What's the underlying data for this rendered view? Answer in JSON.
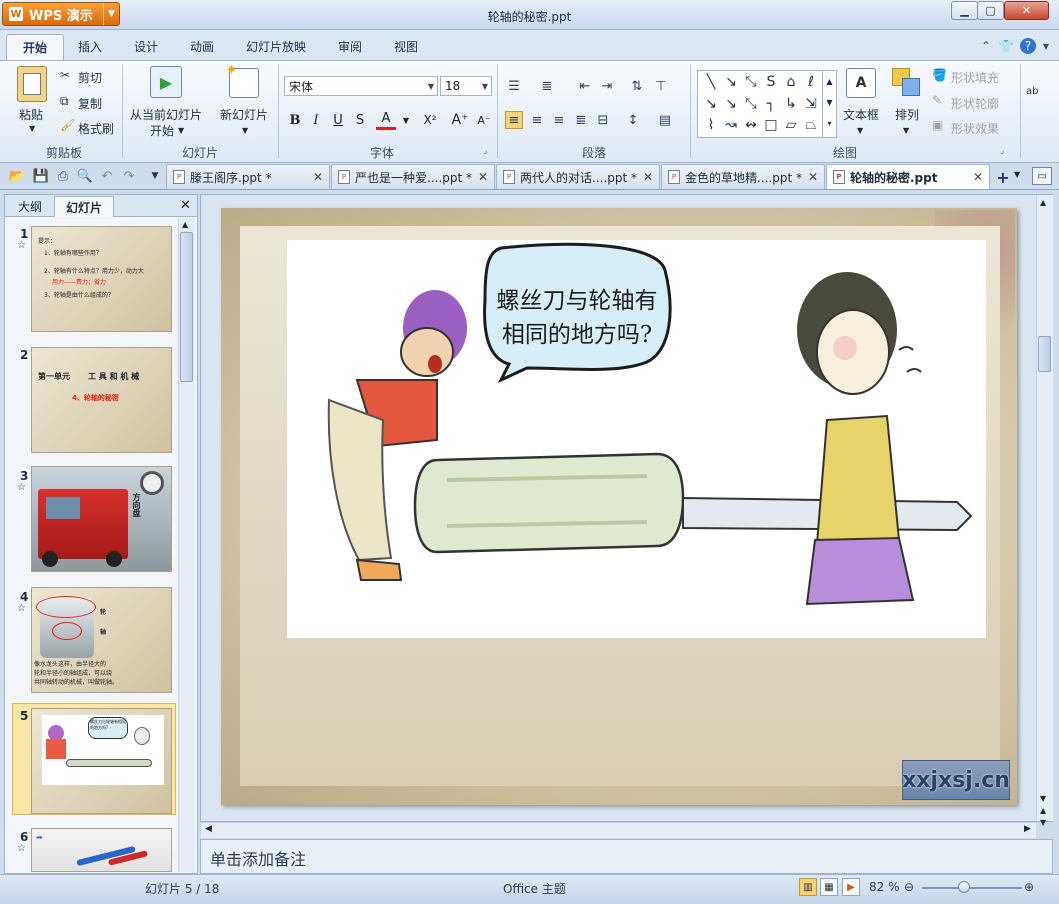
{
  "app": {
    "name": "WPS 演示",
    "window_title": "轮轴的秘密.ppt"
  },
  "ribbon_tabs": [
    "开始",
    "插入",
    "设计",
    "动画",
    "幻灯片放映",
    "审阅",
    "视图"
  ],
  "ribbon": {
    "clipboard": {
      "group": "剪贴板",
      "paste": "粘贴",
      "cut": "剪切",
      "copy": "复制",
      "format_painter": "格式刷"
    },
    "slides": {
      "group": "幻灯片",
      "from_current_line1": "从当前幻灯片",
      "from_current_line2": "开始",
      "new_slide": "新幻灯片"
    },
    "font": {
      "group": "字体",
      "font_name": "宋体",
      "font_size": "18"
    },
    "paragraph": {
      "group": "段落"
    },
    "drawing": {
      "group": "绘图",
      "textbox": "文本框",
      "arrange": "排列",
      "shape_fill": "形状填充",
      "shape_outline": "形状轮廓",
      "shape_effect": "形状效果"
    }
  },
  "doc_tabs": [
    {
      "name": "滕王阁序.ppt *"
    },
    {
      "name": "严也是一种爱....ppt *"
    },
    {
      "name": "两代人的对话....ppt *"
    },
    {
      "name": "金色的草地精....ppt *"
    },
    {
      "name": "轮轴的秘密.ppt"
    }
  ],
  "left_pane": {
    "tab_outline": "大纲",
    "tab_slides": "幻灯片",
    "slides": [
      {
        "num": "1",
        "lines": [
          "提示：",
          "1、轮轴有哪些作用？",
          "2、轮轴有什么特点？用力少，动力大",
          "用力——费力；省力",
          "3、轮轴是由什么组成的？"
        ]
      },
      {
        "num": "2",
        "title_left": "第一单元",
        "title_right": "工 具 和 机 械",
        "subtitle": "4、轮轴的秘密"
      },
      {
        "num": "3",
        "caption": "方向盘"
      },
      {
        "num": "4",
        "lines": [
          "轮",
          "轴",
          "像水龙头这样，由半径大的",
          "轮和半径小的轴组成，可以绕",
          "共同轴转动的机械，叫做轮轴。"
        ]
      },
      {
        "num": "5",
        "bubble": "螺丝刀与轮轴有相同的地方吗?"
      },
      {
        "num": "6"
      }
    ]
  },
  "slide": {
    "speech_bubble": "螺丝刀与轮轴有相同的地方吗?",
    "watermark": "xxjxsj.cn"
  },
  "notes_placeholder": "单击添加备注",
  "status": {
    "slide_counter": "幻灯片 5 / 18",
    "theme": "Office 主题",
    "zoom": "82 %"
  }
}
